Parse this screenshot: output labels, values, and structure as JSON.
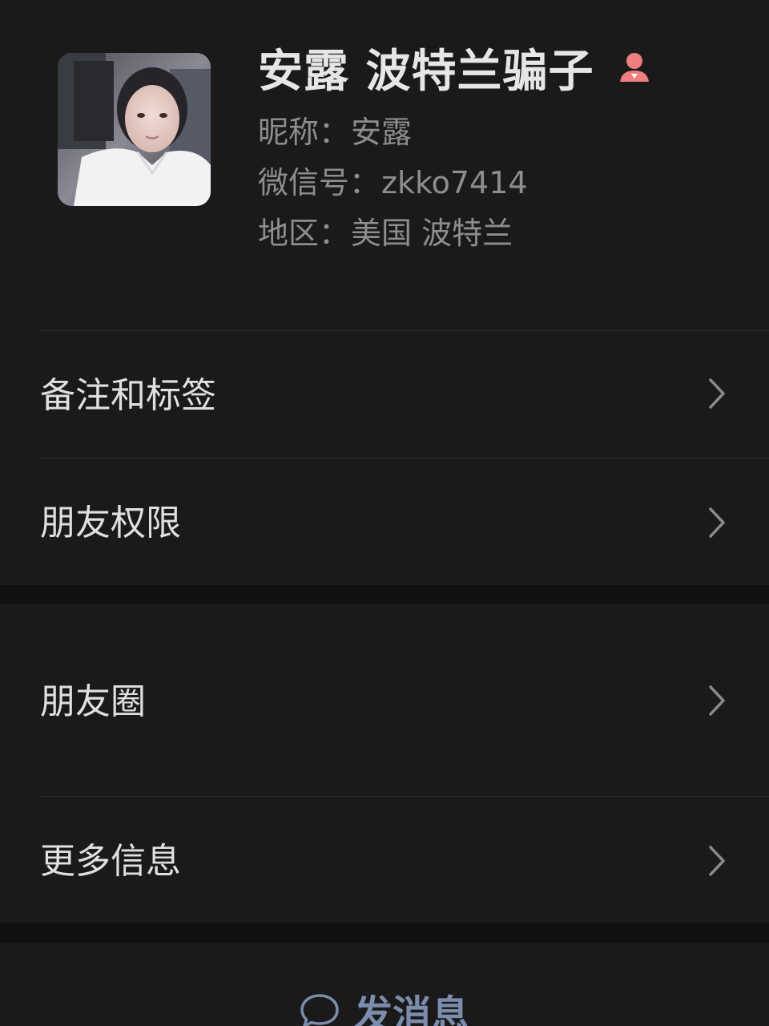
{
  "profile": {
    "display_name": "安露 波特兰骗子",
    "gender_icon": "female-user-icon",
    "nickname_label": "昵称：",
    "nickname": "安露",
    "wechat_id_label": "微信号：",
    "wechat_id": "zkko7414",
    "region_label": "地区：",
    "region": "美国 波特兰",
    "avatar": "profile-photo"
  },
  "menu": {
    "remarks_tags": "备注和标签",
    "friend_permissions": "朋友权限",
    "moments": "朋友圈",
    "more_info": "更多信息"
  },
  "actions": {
    "send_message": "发消息",
    "send_message_icon": "chat-bubble-icon"
  },
  "colors": {
    "background": "#111111",
    "card": "#1a1a1a",
    "accent_link": "#7c8cad",
    "gender_female": "#f07d80"
  }
}
